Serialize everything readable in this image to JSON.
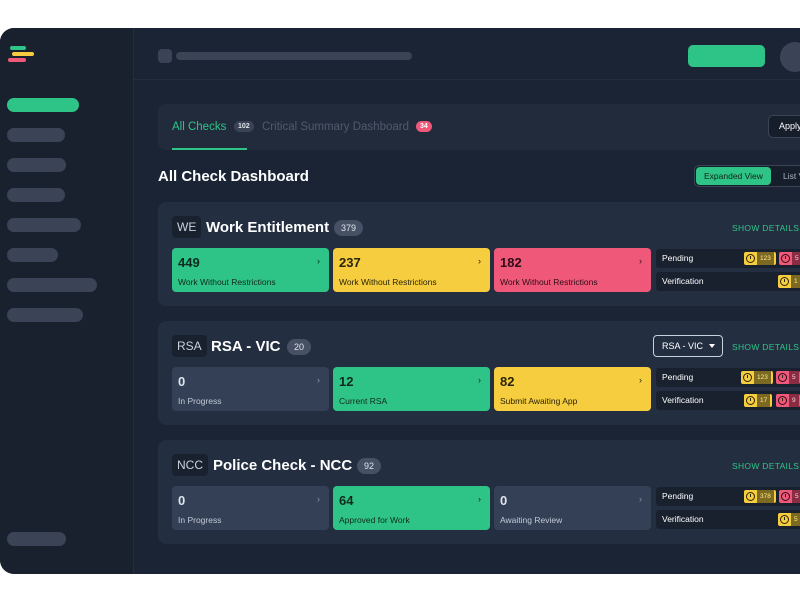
{
  "colors": {
    "accent": "#2fc487",
    "warning": "#f5cd3f",
    "danger": "#f0587a",
    "background": "#1b2434"
  },
  "tabs": {
    "all_checks": {
      "label": "All Checks",
      "badge": "102"
    },
    "critical": {
      "label": "Critical Summary Dashboard",
      "badge": "34"
    },
    "apply_filters": "Apply Filters"
  },
  "dashboard": {
    "title": "All Check Dashboard",
    "view_expanded": "Expanded View",
    "view_list": "List View"
  },
  "cards": [
    {
      "code": "WE",
      "title": "Work Entitlement",
      "count": "379",
      "show_details": "SHOW DETAILS",
      "stats": [
        {
          "value": "449",
          "label": "Work Without Restrictions",
          "arrow": "›"
        },
        {
          "value": "237",
          "label": "Work Without Restrictions",
          "arrow": "›"
        },
        {
          "value": "182",
          "label": "Work Without Restrictions",
          "arrow": "›"
        }
      ],
      "side": [
        {
          "label": "Pending",
          "yellow_num": "123",
          "pink_num": "5"
        },
        {
          "label": "Verification",
          "yellow_num": "1"
        }
      ]
    },
    {
      "code": "RSA",
      "title": "RSA - VIC",
      "count": "20",
      "show_details": "SHOW DETAILS",
      "select": "RSA - VIC",
      "stats": [
        {
          "value": "0",
          "label": "In Progress",
          "arrow": "›"
        },
        {
          "value": "12",
          "label": "Current RSA",
          "arrow": "›"
        },
        {
          "value": "82",
          "label": "Submit Awaiting App",
          "arrow": "›"
        }
      ],
      "side": [
        {
          "label": "Pending",
          "yellow_num": "123",
          "pink_num": "5"
        },
        {
          "label": "Verification",
          "yellow_num": "17",
          "pink_num": "9"
        }
      ]
    },
    {
      "code": "NCC",
      "title": "Police Check - NCC",
      "count": "92",
      "show_details": "SHOW DETAILS",
      "stats": [
        {
          "value": "0",
          "label": "In Progress",
          "arrow": "›"
        },
        {
          "value": "64",
          "label": "Approved for Work",
          "arrow": "›"
        },
        {
          "value": "0",
          "label": "Awaiting Review",
          "arrow": "›"
        }
      ],
      "side": [
        {
          "label": "Pending",
          "yellow_num": "378",
          "pink_num": "5"
        },
        {
          "label": "Verification",
          "yellow_num": "5"
        }
      ]
    }
  ]
}
